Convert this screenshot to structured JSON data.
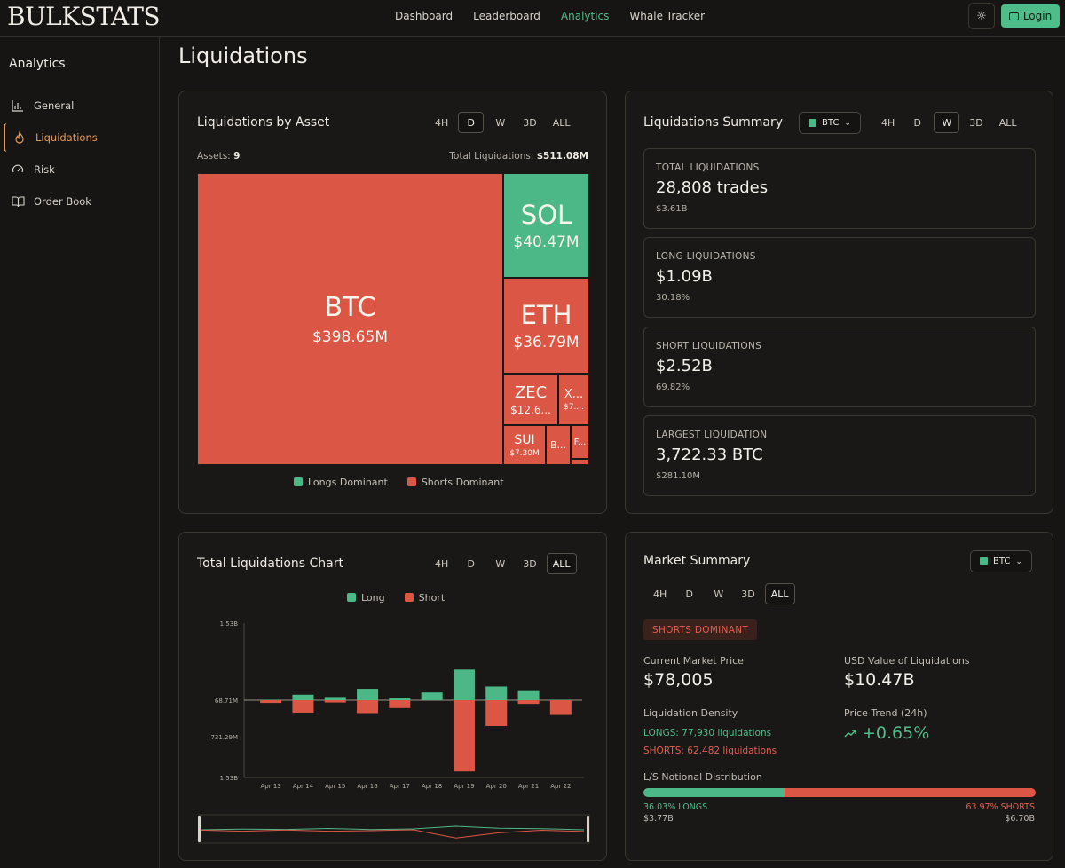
{
  "header": {
    "logo": "BULKSTATS",
    "nav": [
      "Dashboard",
      "Leaderboard",
      "Analytics",
      "Whale Tracker"
    ],
    "active_nav": "Analytics",
    "login": "Login"
  },
  "sidebar": {
    "title": "Analytics",
    "items": [
      {
        "label": "General",
        "icon": "bar-chart-icon"
      },
      {
        "label": "Liquidations",
        "icon": "flame-icon"
      },
      {
        "label": "Risk",
        "icon": "gauge-icon"
      },
      {
        "label": "Order Book",
        "icon": "book-icon"
      }
    ],
    "active": "Liquidations"
  },
  "page_title": "Liquidations",
  "by_asset": {
    "title": "Liquidations by Asset",
    "timeframes": [
      "4H",
      "D",
      "W",
      "3D",
      "ALL"
    ],
    "selected": "D",
    "assets_label": "Assets:",
    "assets_count": "9",
    "total_label": "Total Liquidations:",
    "total_value": "$511.08M",
    "tiles": [
      {
        "sym": "BTC",
        "val": "$398.65M",
        "dominant": "short"
      },
      {
        "sym": "SOL",
        "val": "$40.47M",
        "dominant": "long"
      },
      {
        "sym": "ETH",
        "val": "$36.79M",
        "dominant": "short"
      },
      {
        "sym": "ZEC",
        "val": "$12.6...",
        "dominant": "short"
      },
      {
        "sym": "X...",
        "val": "$7....",
        "dominant": "short"
      },
      {
        "sym": "SUI",
        "val": "$7.30M",
        "dominant": "short"
      },
      {
        "sym": "B...",
        "val": "",
        "dominant": "short"
      },
      {
        "sym": "F...",
        "val": "",
        "dominant": "short"
      }
    ],
    "legend": {
      "long": "Longs Dominant",
      "short": "Shorts Dominant"
    }
  },
  "summary": {
    "title": "Liquidations Summary",
    "asset": "BTC",
    "timeframes": [
      "4H",
      "D",
      "W",
      "3D",
      "ALL"
    ],
    "selected": "W",
    "boxes": [
      {
        "label": "TOTAL LIQUIDATIONS",
        "big": "28,808 trades",
        "sub": "$3.61B",
        "tone": "neutral"
      },
      {
        "label": "LONG LIQUIDATIONS",
        "big": "$1.09B",
        "sub": "30.18%",
        "tone": "green"
      },
      {
        "label": "SHORT LIQUIDATIONS",
        "big": "$2.52B",
        "sub": "69.82%",
        "tone": "red"
      },
      {
        "label": "LARGEST LIQUIDATION",
        "big": "3,722.33 BTC",
        "sub": "$281.10M",
        "tone": "neutral"
      }
    ]
  },
  "total_chart": {
    "title": "Total Liquidations Chart",
    "timeframes": [
      "4H",
      "D",
      "W",
      "3D",
      "ALL"
    ],
    "selected": "ALL",
    "legend": {
      "long": "Long",
      "short": "Short"
    }
  },
  "chart_data": {
    "type": "bar",
    "categories": [
      "Apr 13",
      "Apr 14",
      "Apr 15",
      "Apr 16",
      "Apr 17",
      "Apr 18",
      "Apr 19",
      "Apr 20",
      "Apr 21",
      "Apr 22"
    ],
    "series": [
      {
        "name": "Long",
        "values": [
          0.01,
          0.12,
          0.07,
          0.25,
          0.04,
          0.17,
          0.67,
          0.3,
          0.2,
          0.01
        ]
      },
      {
        "name": "Short",
        "values": [
          -0.06,
          -0.27,
          -0.05,
          -0.28,
          -0.17,
          0,
          -1.55,
          -0.56,
          -0.08,
          -0.32
        ]
      }
    ],
    "units": "B",
    "yticks": [
      "1.53B",
      "68.71M",
      "731.29M",
      "1.53B"
    ],
    "ylim": [
      -1.53,
      1.53
    ],
    "colors": {
      "Long": "#4db887",
      "Short": "#dc5646"
    }
  },
  "market": {
    "title": "Market Summary",
    "asset": "BTC",
    "timeframes": [
      "4H",
      "D",
      "W",
      "3D",
      "ALL"
    ],
    "selected": "ALL",
    "badge": "SHORTS DOMINANT",
    "price_label": "Current Market Price",
    "price": "$78,005",
    "usd_label": "USD Value of Liquidations",
    "usd": "$10.47B",
    "density_label": "Liquidation Density",
    "longs_density": "LONGS: 77,930 liquidations",
    "shorts_density": "SHORTS: 62,482 liquidations",
    "trend_label": "Price Trend (24h)",
    "trend": "+0.65%",
    "dist_label": "L/S Notional Distribution",
    "long_pct": 36.03,
    "long_pct_label": "36.03% LONGS",
    "short_pct_label": "63.97% SHORTS",
    "long_value": "$3.77B",
    "short_value": "$6.70B"
  }
}
